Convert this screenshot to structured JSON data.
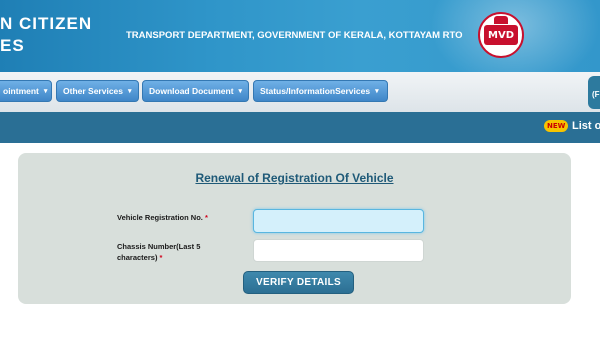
{
  "header": {
    "portal_line1": "N CITIZEN",
    "portal_line2": "ES",
    "department": "TRANSPORT DEPARTMENT, GOVERNMENT OF KERALA, KOTTAYAM RTO",
    "logo_text": "MVD",
    "banner_color": "#2f95c9"
  },
  "menu": {
    "items": [
      {
        "label": "ointment",
        "icon": "caret-down-icon"
      },
      {
        "label": "Other Services",
        "icon": "caret-down-icon"
      },
      {
        "label": "Download Document",
        "icon": "caret-down-icon"
      },
      {
        "label": "Status/InformationServices",
        "icon": "caret-down-icon"
      }
    ],
    "caret": "▾",
    "login_stub_text": "(F"
  },
  "news": {
    "badge": "NEW",
    "text": "List o"
  },
  "form": {
    "title": "Renewal of Registration Of Vehicle",
    "reg_label": "Vehicle Registration No.",
    "chassis_label_line1": "Chassis Number(Last 5",
    "chassis_label_line2": "characters)",
    "required_marker": "*",
    "reg_value": "",
    "chassis_value": "",
    "verify_label": "VERIFY DETAILS"
  }
}
